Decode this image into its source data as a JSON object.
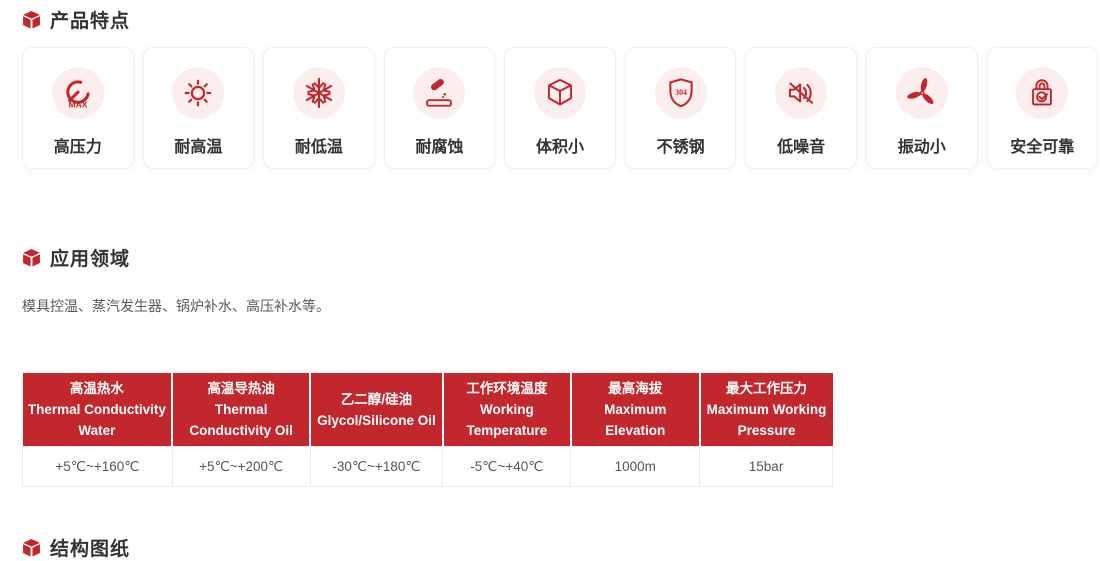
{
  "theme": {
    "accent": "#c1272d",
    "icon_bg": "#fdeeee",
    "table_header_text": "#ffffff"
  },
  "features": {
    "title": "产品特点",
    "items": [
      {
        "label": "高压力",
        "icon": "gauge-max-icon"
      },
      {
        "label": "耐高温",
        "icon": "sun-icon"
      },
      {
        "label": "耐低温",
        "icon": "snowflake-icon"
      },
      {
        "label": "耐腐蚀",
        "icon": "corrosion-drop-icon"
      },
      {
        "label": "体积小",
        "icon": "cube-outline-icon"
      },
      {
        "label": "不锈钢",
        "icon": "shield-304-icon"
      },
      {
        "label": "低噪音",
        "icon": "speaker-muted-icon"
      },
      {
        "label": "振动小",
        "icon": "fan-propeller-icon"
      },
      {
        "label": "安全可靠",
        "icon": "lock-check-icon"
      }
    ],
    "shield_text": "304",
    "gauge_text": "MAX"
  },
  "application": {
    "title": "应用领域",
    "description": "模具控温、蒸汽发生器、锅炉补水、高压补水等。"
  },
  "specs_table": {
    "columns": [
      {
        "name_cn": "高温热水",
        "name_en": "Thermal Conductivity Water",
        "value": "+5℃~+160℃"
      },
      {
        "name_cn": "高温导热油",
        "name_en": "Thermal Conductivity Oil",
        "value": "+5℃~+200℃"
      },
      {
        "name_cn": "乙二醇/硅油",
        "name_en": "Glycol/Silicone Oil",
        "value": "-30℃~+180℃"
      },
      {
        "name_cn": "工作环境温度",
        "name_en": "Working Temperature",
        "value": "-5℃~+40℃"
      },
      {
        "name_cn": "最高海拔",
        "name_en": "Maximum Elevation",
        "value": "1000m"
      },
      {
        "name_cn": "最大工作压力",
        "name_en": "Maximum Working Pressure",
        "value": "15bar"
      }
    ]
  },
  "drawings": {
    "title": "结构图纸"
  }
}
